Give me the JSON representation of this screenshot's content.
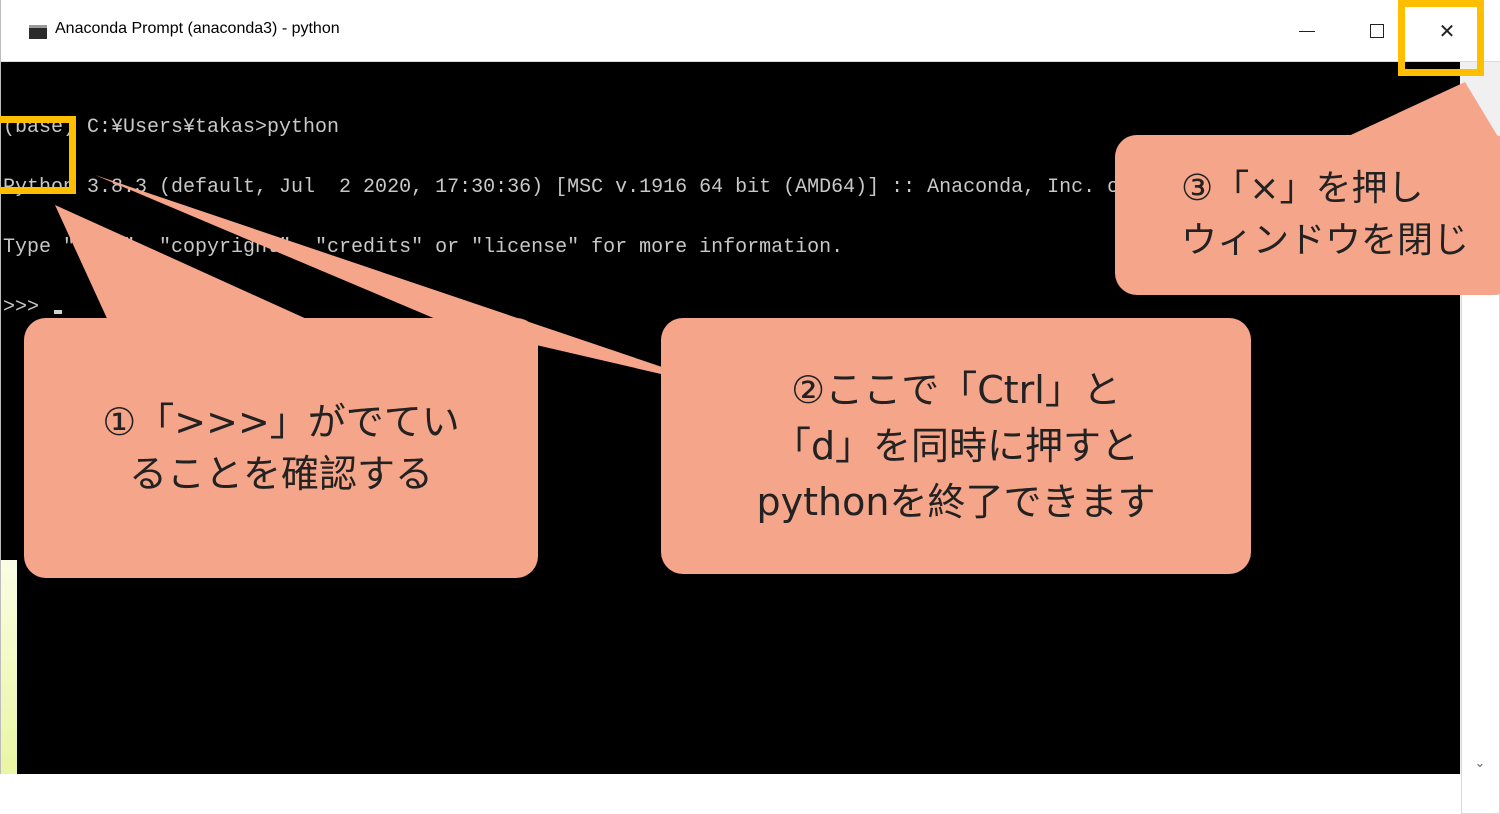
{
  "window": {
    "title": "Anaconda Prompt (anaconda3) - python",
    "controls": {
      "minimize_icon": "minimize-icon",
      "maximize_icon": "maximize-icon",
      "close_icon": "close-icon",
      "close_glyph": "✕"
    }
  },
  "console": {
    "lines": [
      "(base) C:¥Users¥takas>python",
      "Python 3.8.3 (default, Jul  2 2020, 17:30:36) [MSC v.1916 64 bit (AMD64)] :: Anaconda, Inc. on win32",
      "Type \"help\", \"copyright\", \"credits\" or \"license\" for more information."
    ],
    "prompt": ">>>"
  },
  "scrollbar": {
    "down_glyph": "⌄"
  },
  "callouts": {
    "step1": {
      "line1": "①「>>>」がでてい",
      "line2": "ることを確認する"
    },
    "step2": {
      "line1": "②ここで「Ctrl」と",
      "line2": "「d」を同時に押すと",
      "line3": "pythonを終了できます"
    },
    "step3": {
      "line1": "③「×」を押し",
      "line2": "ウィンドウを閉じ"
    }
  },
  "colors": {
    "callout_fill": "#f5a589",
    "highlight_border": "#ffbf00",
    "console_bg": "#000000",
    "console_text": "#c8c8c8"
  }
}
